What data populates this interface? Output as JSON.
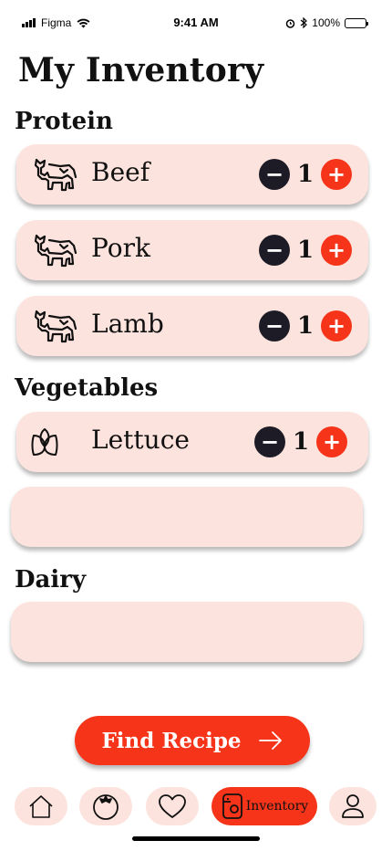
{
  "status_bar": {
    "carrier": "Figma",
    "time": "9:41 AM",
    "battery": "100%"
  },
  "page_title": "My Inventory",
  "sections": {
    "protein": {
      "title": "Protein",
      "items": [
        {
          "label": "Beef",
          "quantity": "1",
          "icon": "cow-icon"
        },
        {
          "label": "Pork",
          "quantity": "1",
          "icon": "cow-icon"
        },
        {
          "label": "Lamb",
          "quantity": "1",
          "icon": "cow-icon"
        }
      ]
    },
    "vegetables": {
      "title": "Vegetables",
      "items": [
        {
          "label": "Lettuce",
          "quantity": "1",
          "icon": "leaf-icon"
        }
      ]
    },
    "dairy": {
      "title": "Dairy",
      "items": []
    }
  },
  "controls": {
    "minus": "−",
    "plus": "+"
  },
  "find_recipe": {
    "label": "Find Recipe",
    "icon": "arrow-right-icon"
  },
  "bottom_nav": {
    "items": [
      {
        "icon": "home-icon"
      },
      {
        "icon": "tomato-icon"
      },
      {
        "icon": "heart-icon"
      },
      {
        "icon": "fridge-icon",
        "label": "Inventory",
        "active": true
      },
      {
        "icon": "profile-icon"
      }
    ]
  },
  "colors": {
    "accent": "#f5341a",
    "card": "#fde3dd",
    "minus_button": "#1d1b26",
    "text": "#111111"
  }
}
